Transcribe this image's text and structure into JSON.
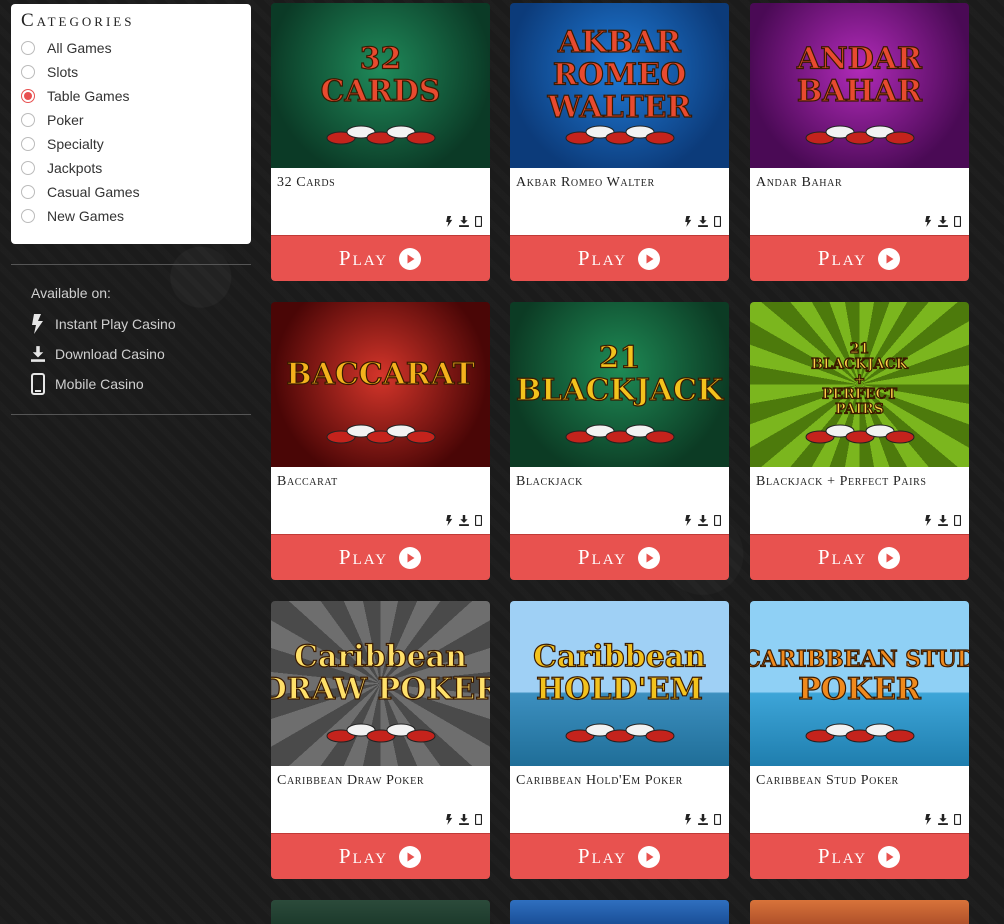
{
  "categories": {
    "title": "Categories",
    "items": [
      {
        "label": "All Games",
        "selected": false
      },
      {
        "label": "Slots",
        "selected": false
      },
      {
        "label": "Table Games",
        "selected": true
      },
      {
        "label": "Poker",
        "selected": false
      },
      {
        "label": "Specialty",
        "selected": false
      },
      {
        "label": "Jackpots",
        "selected": false
      },
      {
        "label": "Casual Games",
        "selected": false
      },
      {
        "label": "New Games",
        "selected": false
      }
    ]
  },
  "availability": {
    "title": "Available on:",
    "items": [
      {
        "label": "Instant Play Casino",
        "icon": "lightning-icon"
      },
      {
        "label": "Download Casino",
        "icon": "download-icon"
      },
      {
        "label": "Mobile Casino",
        "icon": "mobile-icon"
      }
    ]
  },
  "games": [
    {
      "name": "32 Cards",
      "logo_lines": [
        "32",
        "CARDS"
      ]
    },
    {
      "name": "Akbar Romeo Walter",
      "logo_lines": [
        "AKBAR",
        "ROMEO",
        "WALTER"
      ]
    },
    {
      "name": "Andar Bahar",
      "logo_lines": [
        "ANDAR",
        "BAHAR"
      ]
    },
    {
      "name": "Baccarat",
      "logo_lines": [
        "BACCARAT"
      ]
    },
    {
      "name": "Blackjack",
      "logo_lines": [
        "21",
        "BLACKJACK"
      ]
    },
    {
      "name": "Blackjack + Perfect Pairs",
      "logo_lines": [
        "21",
        "BLACKJACK",
        "+",
        "PERFECT",
        "PAIRS"
      ]
    },
    {
      "name": "Caribbean Draw Poker",
      "logo_lines": [
        "Caribbean",
        "DRAW POKER"
      ]
    },
    {
      "name": "Caribbean Hold'Em Poker",
      "logo_lines": [
        "Caribbean",
        "HOLD'EM"
      ]
    },
    {
      "name": "Caribbean Stud Poker",
      "logo_lines": [
        "CARIBBEAN STUD",
        "POKER"
      ]
    }
  ],
  "play_label": "Play",
  "colors": {
    "accent": "#e8524f",
    "background": "#1b1b1b"
  }
}
